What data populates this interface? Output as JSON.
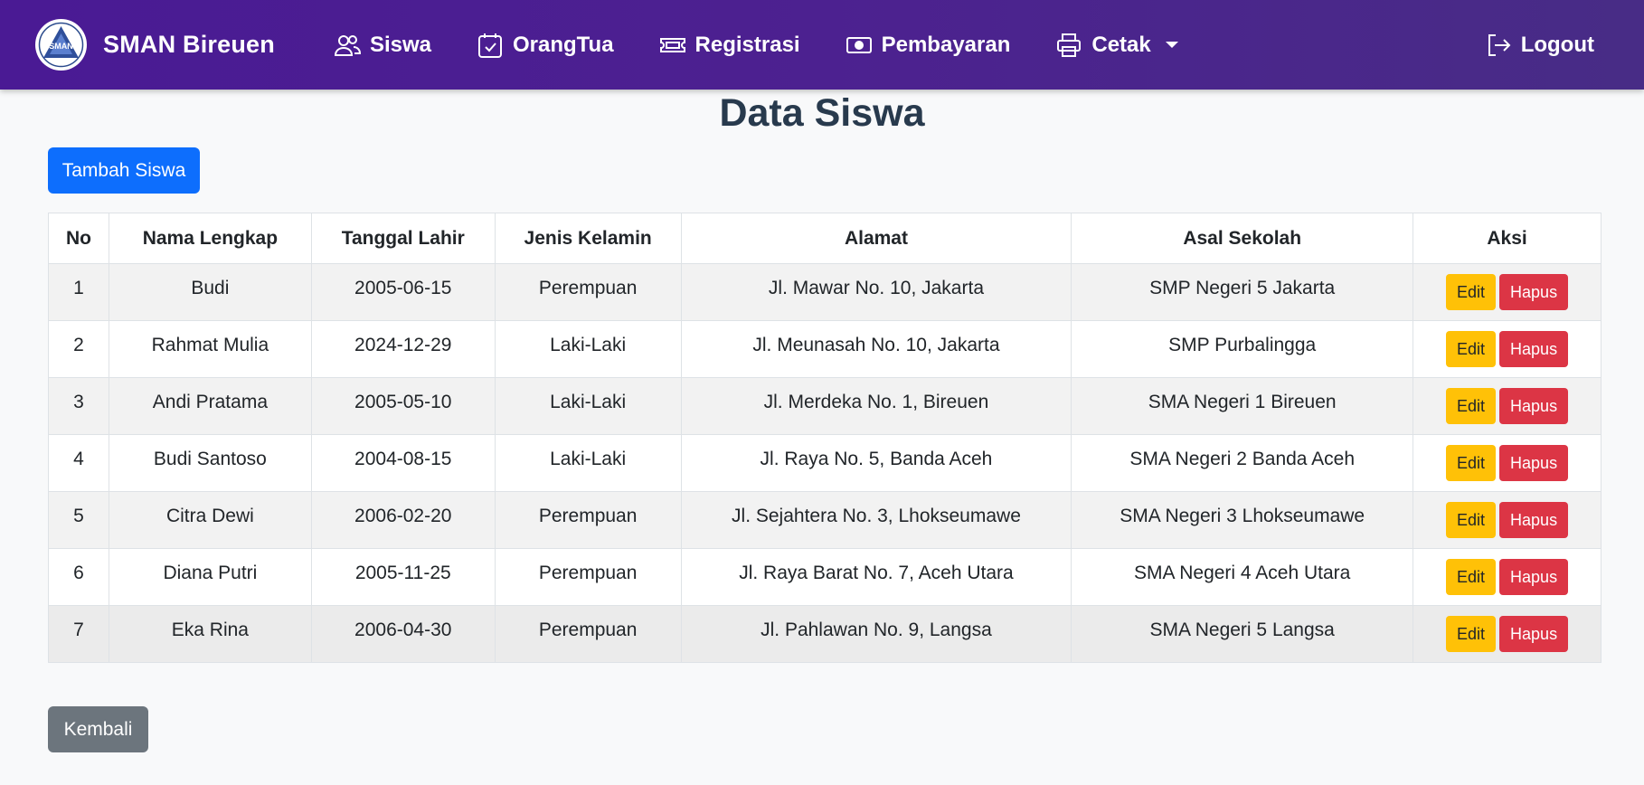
{
  "navbar": {
    "brand": "SMAN Bireuen",
    "logo_text": "SMAN",
    "items": [
      {
        "label": "Siswa",
        "icon": "people-icon"
      },
      {
        "label": "OrangTua",
        "icon": "calendar-check-icon"
      },
      {
        "label": "Registrasi",
        "icon": "ticket-icon"
      },
      {
        "label": "Pembayaran",
        "icon": "cash-icon"
      },
      {
        "label": "Cetak",
        "icon": "printer-icon"
      }
    ],
    "logout": "Logout"
  },
  "page": {
    "title": "Data Siswa",
    "add_button": "Tambah Siswa",
    "back_button": "Kembali"
  },
  "table": {
    "headers": [
      "No",
      "Nama Lengkap",
      "Tanggal Lahir",
      "Jenis Kelamin",
      "Alamat",
      "Asal Sekolah",
      "Aksi"
    ],
    "edit_label": "Edit",
    "delete_label": "Hapus",
    "rows": [
      [
        "1",
        "Budi",
        "2005-06-15",
        "Perempuan",
        "Jl. Mawar No. 10, Jakarta",
        "SMP Negeri 5 Jakarta"
      ],
      [
        "2",
        "Rahmat Mulia",
        "2024-12-29",
        "Laki-Laki",
        "Jl. Meunasah No. 10, Jakarta",
        "SMP Purbalingga"
      ],
      [
        "3",
        "Andi Pratama",
        "2005-05-10",
        "Laki-Laki",
        "Jl. Merdeka No. 1, Bireuen",
        "SMA Negeri 1 Bireuen"
      ],
      [
        "4",
        "Budi Santoso",
        "2004-08-15",
        "Laki-Laki",
        "Jl. Raya No. 5, Banda Aceh",
        "SMA Negeri 2 Banda Aceh"
      ],
      [
        "5",
        "Citra Dewi",
        "2006-02-20",
        "Perempuan",
        "Jl. Sejahtera No. 3, Lhokseumawe",
        "SMA Negeri 3 Lhokseumawe"
      ],
      [
        "6",
        "Diana Putri",
        "2005-11-25",
        "Perempuan",
        "Jl. Raya Barat No. 7, Aceh Utara",
        "SMA Negeri 4 Aceh Utara"
      ],
      [
        "7",
        "Eka Rina",
        "2006-04-30",
        "Perempuan",
        "Jl. Pahlawan No. 9, Langsa",
        "SMA Negeri 5 Langsa"
      ]
    ]
  },
  "colors": {
    "navbar": "#4a1a94",
    "primary": "#0d6efd",
    "secondary": "#6c757d",
    "warning": "#ffc107",
    "danger": "#dc3545",
    "title": "#283a4d"
  }
}
